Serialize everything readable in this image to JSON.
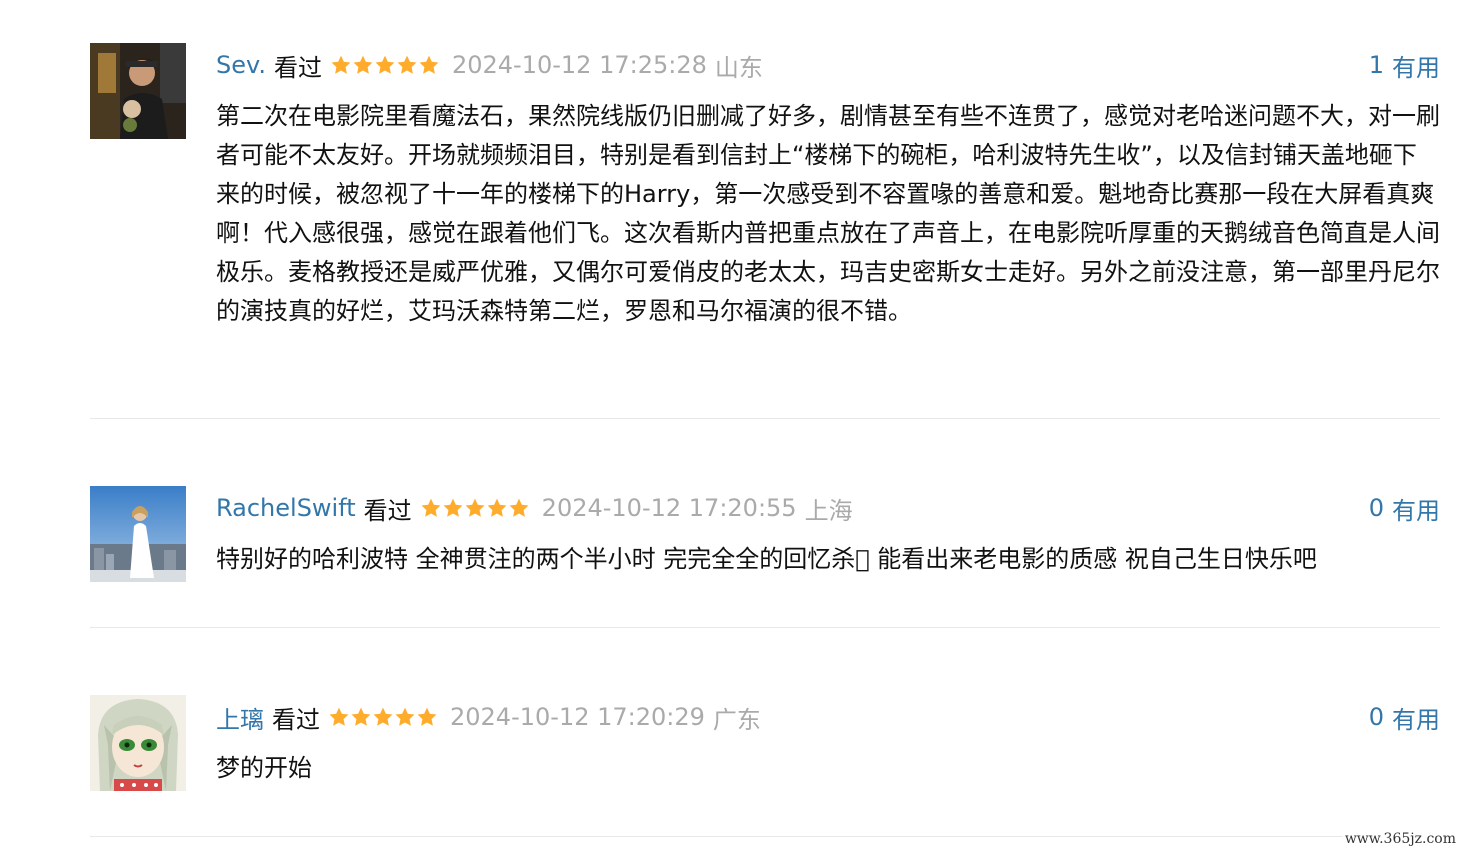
{
  "comments": [
    {
      "author": "Sev.",
      "status": "看过",
      "rating": 5,
      "time": "2024-10-12 17:25:28",
      "location": "山东",
      "votes": "1",
      "useful_label": "有用",
      "text": "第二次在电影院里看魔法石，果然院线版仍旧删减了好多，剧情甚至有些不连贯了，感觉对老哈迷问题不大，对一刷者可能不太友好。开场就频频泪目，特别是看到信封上“楼梯下的碗柜，哈利波特先生收”，以及信封铺天盖地砸下来的时候，被忽视了十一年的楼梯下的Harry，第一次感受到不容置喙的善意和爱。魁地奇比赛那一段在大屏看真爽啊！代入感很强，感觉在跟着他们飞。这次看斯内普把重点放在了声音上，在电影院听厚重的天鹅绒音色简直是人间极乐。麦格教授还是威严优雅，又偶尔可爱俏皮的老太太，玛吉史密斯女士走好。另外之前没注意，第一部里丹尼尔的演技真的好烂，艾玛沃森特第二烂，罗恩和马尔福演的很不错。"
    },
    {
      "author": "RachelSwift",
      "status": "看过",
      "rating": 5,
      "time": "2024-10-12 17:20:55",
      "location": "上海",
      "votes": "0",
      "useful_label": "有用",
      "text": "特别好的哈利波特 全神贯注的两个半小时 完完全全的回忆杀􏿽 能看出来老电影的质感 祝自己生日快乐吧"
    },
    {
      "author": "上璃",
      "status": "看过",
      "rating": 5,
      "time": "2024-10-12 17:20:29",
      "location": "广东",
      "votes": "0",
      "useful_label": "有用",
      "text": "梦的开始"
    }
  ],
  "watermark": "www.365jz.com",
  "colors": {
    "link": "#3377aa",
    "star": "#ffac2d",
    "meta_gray": "#aaaaaa",
    "divider": "#e8e8e8"
  }
}
